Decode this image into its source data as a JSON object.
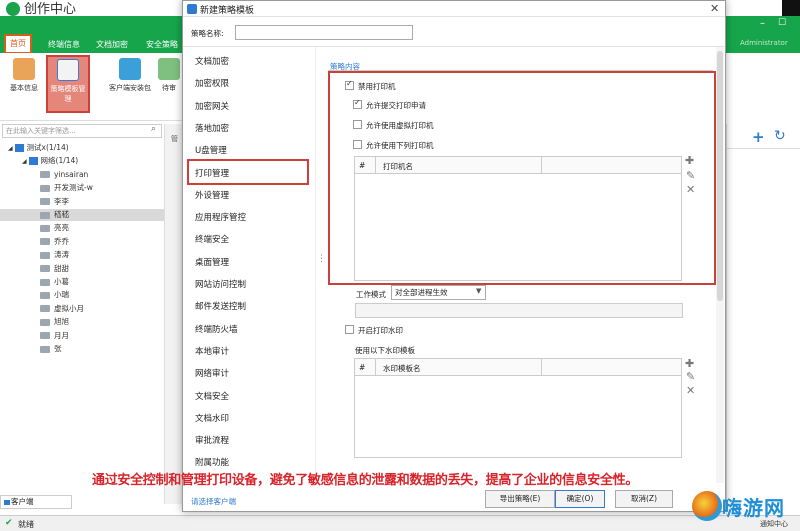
{
  "app": {
    "title": "创作中心",
    "ribbon_tabs": [
      "首页",
      "终端信息",
      "文档加密",
      "安全策略"
    ],
    "user": "Administrator",
    "toolbar": [
      "基本信息",
      "策略模板管理",
      "客户端安装包",
      "待审"
    ],
    "search_placeholder": "在此输入关键字筛选...",
    "tree": [
      {
        "label": "测试x(1/14)",
        "level": 0
      },
      {
        "label": "网络(1/14)",
        "level": 1
      },
      {
        "label": "yinsairan",
        "level": 2
      },
      {
        "label": "开发测试-w",
        "level": 2
      },
      {
        "label": "李李",
        "level": 2
      },
      {
        "label": "嵇嵇",
        "level": 2,
        "selected": true
      },
      {
        "label": "亮亮",
        "level": 2
      },
      {
        "label": "乔乔",
        "level": 2
      },
      {
        "label": "涛涛",
        "level": 2
      },
      {
        "label": "甜甜",
        "level": 2
      },
      {
        "label": "小葛",
        "level": 2
      },
      {
        "label": "小瑞",
        "level": 2
      },
      {
        "label": "虚拟小月",
        "level": 2
      },
      {
        "label": "旭旭",
        "level": 2
      },
      {
        "label": "月月",
        "level": 2
      },
      {
        "label": "张",
        "level": 2
      }
    ],
    "client_tab": "客户端",
    "status": "就绪",
    "notify": "通知中心",
    "middle_tab": "管"
  },
  "dialog": {
    "title": "新建策略模板",
    "policy_name_label": "策略名称:",
    "policy_name_value": "",
    "nav": [
      "文档加密",
      "加密权限",
      "加密网关",
      "落地加密",
      "U盘管理",
      "打印管理",
      "外设管理",
      "应用程序管控",
      "终端安全",
      "桌面管理",
      "网站访问控制",
      "邮件发送控制",
      "终端防火墙",
      "本地审计",
      "网络审计",
      "文档安全",
      "文档水印",
      "审批流程",
      "附属功能"
    ],
    "nav_selected": "打印管理",
    "choose_client": "请选择客户端",
    "content_title": "策略内容",
    "disable_printer": {
      "label": "禁用打印机",
      "checked": true
    },
    "allow_submit": {
      "label": "允许提交打印申请",
      "checked": true
    },
    "allow_virtual": {
      "label": "允许使用虚拟打印机",
      "checked": false
    },
    "allow_listed": {
      "label": "允许使用下列打印机",
      "checked": false
    },
    "printer_grid": {
      "col_num": "#",
      "col_name": "打印机名"
    },
    "workmode_label": "工作模式",
    "workmode_value": "对全部进程生效",
    "watermark_chk": {
      "label": "开启打印水印",
      "checked": false
    },
    "watermark_template_label": "使用以下水印模板",
    "watermark_grid": {
      "col_num": "#",
      "col_name": "水印模板名"
    },
    "buttons": {
      "export": "导出策略(E)",
      "ok": "确定(O)",
      "cancel": "取消(Z)"
    }
  },
  "caption": "通过安全控制和管理打印设备，避免了敏感信息的泄露和数据的丢失，提高了企业的信息安全性。",
  "watermark": "嗨游网",
  "colors": {
    "brand_green": "#17a54b",
    "highlight_red": "#c9413a",
    "link_blue": "#2e7bd1",
    "caption_red": "#d8232a"
  }
}
